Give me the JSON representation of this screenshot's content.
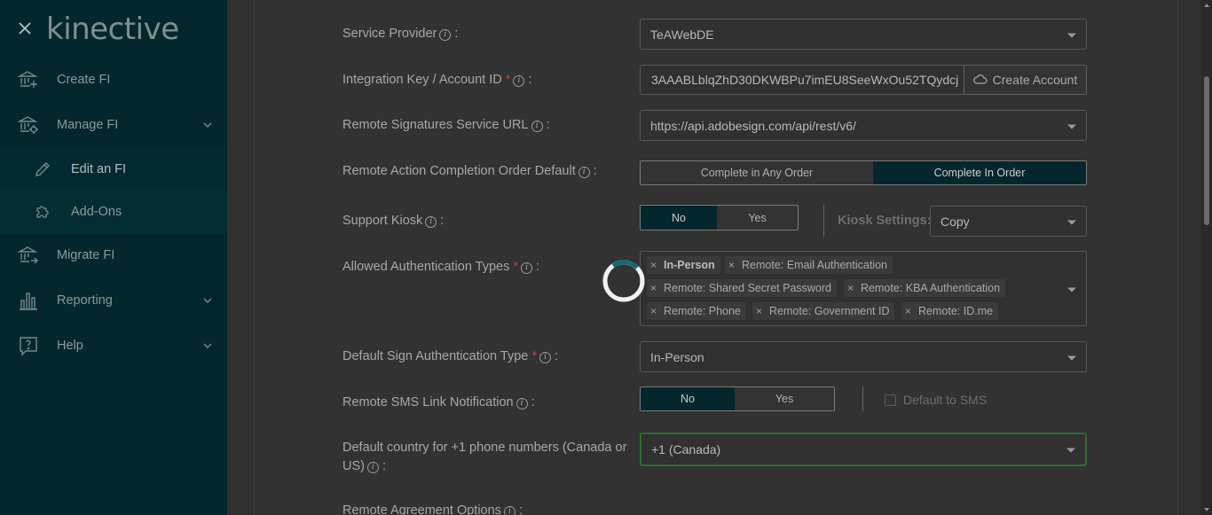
{
  "sidebar": {
    "logo": "kinective",
    "items": [
      {
        "label": "Create FI",
        "icon": "bank-plus-icon"
      },
      {
        "label": "Manage FI",
        "icon": "bank-gear-icon"
      },
      {
        "label": "Edit an FI",
        "icon": "pencil-icon"
      },
      {
        "label": "Add-Ons",
        "icon": "puzzle-icon"
      },
      {
        "label": "Migrate FI",
        "icon": "bank-arrow-icon"
      },
      {
        "label": "Reporting",
        "icon": "bar-chart-icon"
      },
      {
        "label": "Help",
        "icon": "help-icon"
      }
    ]
  },
  "form": {
    "service_provider": {
      "label": "Service Provider",
      "value": "TeAWebDE"
    },
    "integration_key": {
      "label": "Integration Key / Account ID",
      "value": "3AAABLblqZhD30DKWBPu7imEU8SeeWxOu52TQydcj",
      "button": "Create Account"
    },
    "remote_signatures_url": {
      "label": "Remote Signatures Service URL",
      "value": "https://api.adobesign.com/api/rest/v6/"
    },
    "completion_order": {
      "label": "Remote Action Completion Order Default",
      "options": [
        "Complete in Any Order",
        "Complete In Order"
      ],
      "selected": "Complete In Order"
    },
    "support_kiosk": {
      "label": "Support Kiosk",
      "options": [
        "No",
        "Yes"
      ],
      "selected": "No",
      "settings_label": "Kiosk Settings:",
      "settings_value": "Copy"
    },
    "auth_types": {
      "label": "Allowed Authentication Types",
      "tags": [
        "In-Person",
        "Remote: Email Authentication",
        "Remote: Shared Secret Password",
        "Remote: KBA Authentication",
        "Remote: Phone",
        "Remote: Government ID",
        "Remote: ID.me"
      ]
    },
    "default_sign_auth": {
      "label": "Default Sign Authentication Type",
      "value": "In-Person"
    },
    "sms_notification": {
      "label": "Remote SMS Link Notification",
      "options": [
        "No",
        "Yes"
      ],
      "selected": "No",
      "checkbox_label": "Default to SMS"
    },
    "default_country": {
      "label_line1": "Default country for +1 phone numbers (Canada or",
      "label_line2": "US)",
      "value": "+1 (Canada)"
    },
    "remote_agreement": {
      "label": "Remote Agreement Options"
    }
  },
  "colors": {
    "sidebar_bg": "#03272c",
    "accent_green": "#2e6b2e",
    "spinner": "#0f6a73"
  }
}
